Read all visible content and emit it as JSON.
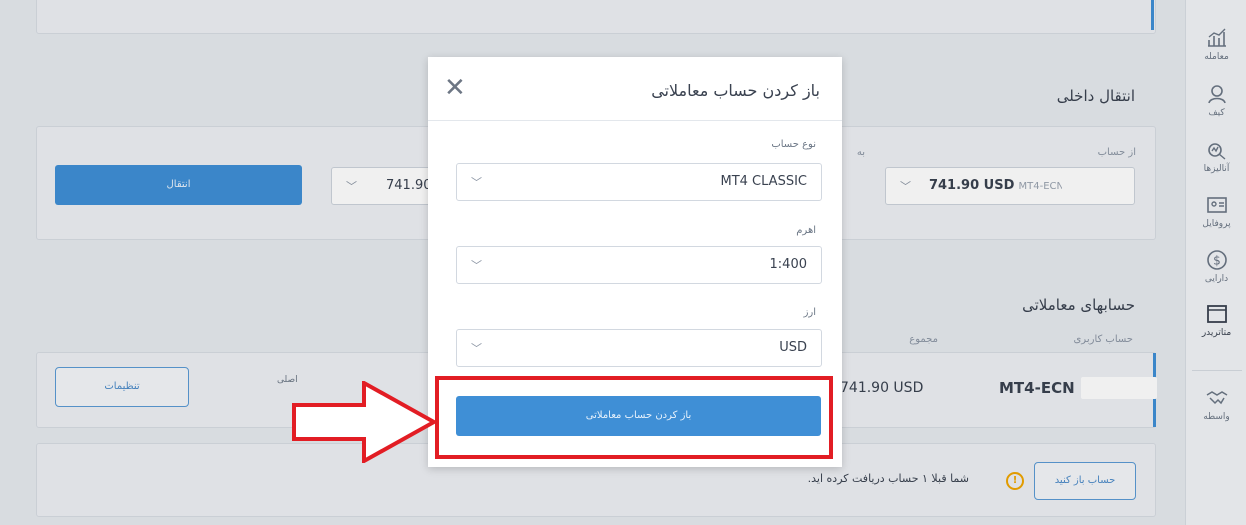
{
  "sidebar": {
    "items": [
      {
        "label": "معامله",
        "icon": "chart-icon"
      },
      {
        "label": "کیف",
        "icon": "user-icon"
      },
      {
        "label": "آنالیزها",
        "icon": "analytics-icon"
      },
      {
        "label": "پروفایل",
        "icon": "profile-card-icon"
      },
      {
        "label": "دارایی",
        "icon": "dollar-icon"
      },
      {
        "label": "متاتریدر",
        "icon": "window-icon"
      },
      {
        "label": "واسطه",
        "icon": "handshake-icon"
      }
    ]
  },
  "transfer": {
    "title": "انتقال داخلی",
    "from_label": "از حساب",
    "from_value": "741.90 USD",
    "from_account": "MT4-ECN",
    "to_label": "به",
    "to_value": "741.90",
    "button": "انتقال"
  },
  "accounts": {
    "title": "حسابهای معاملاتی",
    "col_user": "حساب کاربری",
    "col_total": "مجموع",
    "row": {
      "name": "MT4-ECN",
      "total": "741.90 USD",
      "type": "اصلی",
      "settings": "تنظیمات"
    }
  },
  "footer": {
    "open_button": "حساب باز کنید",
    "notice": "شما قبلا ۱ حساب دریافت کرده اید."
  },
  "modal": {
    "title": "باز کردن حساب معاملاتی",
    "account_type_label": "نوع حساب",
    "account_type_value": "MT4 CLASSIC",
    "leverage_label": "اهرم",
    "leverage_value": "1:400",
    "currency_label": "ارز",
    "currency_value": "USD",
    "submit": "باز کردن حساب معاملاتی"
  },
  "colors": {
    "accent": "#3f8fd6",
    "highlight": "#e21d24"
  }
}
